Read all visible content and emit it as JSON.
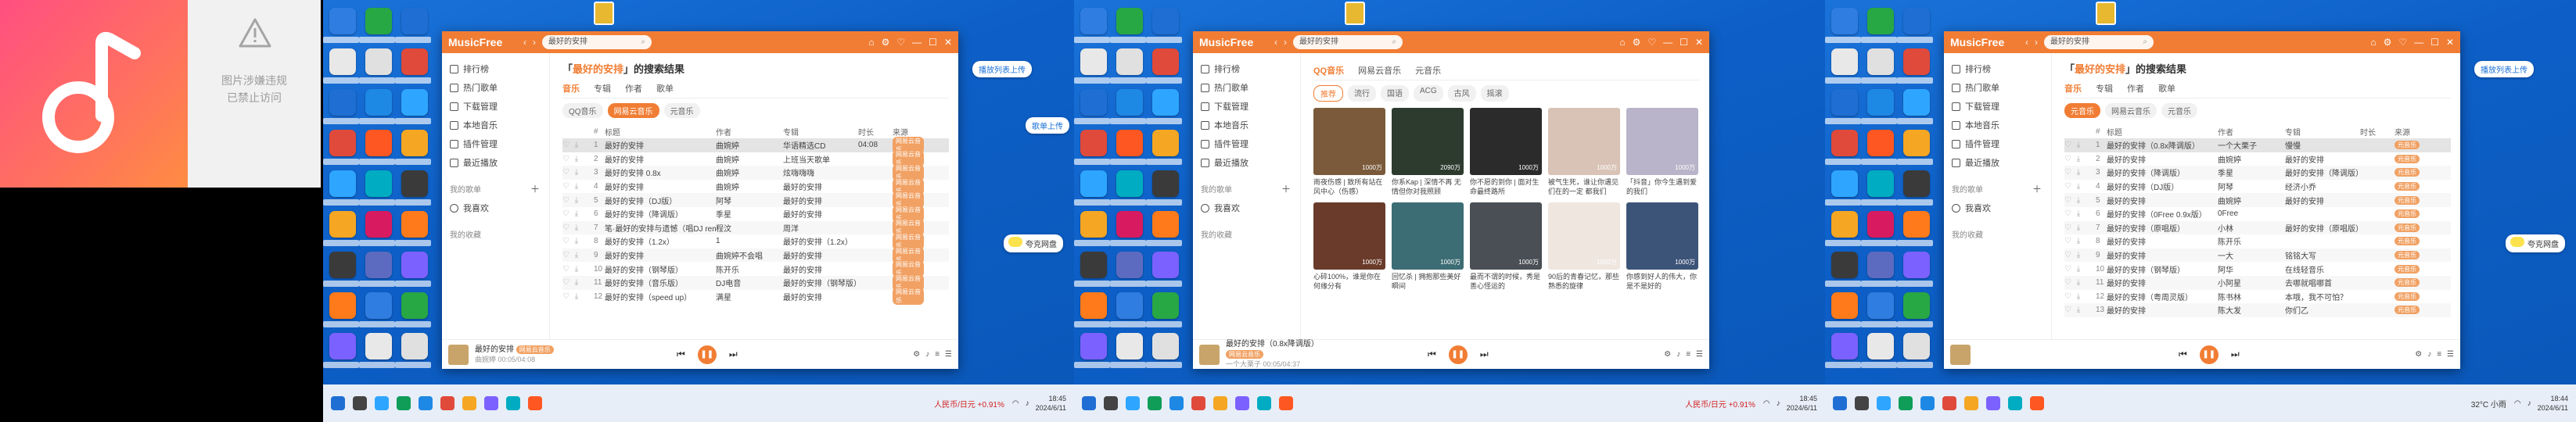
{
  "placeholder": {
    "line1": "图片涉嫌违规",
    "line2": "已禁止访问"
  },
  "app": {
    "name": "MusicFree",
    "nav_back": "‹",
    "nav_forward": "›",
    "window_controls": [
      "⌂",
      "⚙",
      "♡",
      "—",
      "☐",
      "✕"
    ]
  },
  "sidebar": {
    "items": [
      {
        "label": "排行榜"
      },
      {
        "label": "热门歌单"
      },
      {
        "label": "下载管理"
      },
      {
        "label": "本地音乐"
      },
      {
        "label": "插件管理"
      },
      {
        "label": "最近播放"
      }
    ],
    "my_playlists": "我的歌单",
    "fav": "我喜欢",
    "collected": "我的收藏"
  },
  "screens": [
    {
      "search": "最好的安排",
      "query": "最好的安排",
      "title_suffix": "的搜索结果",
      "tabs": [
        "音乐",
        "专辑",
        "作者",
        "歌单"
      ],
      "active_tab": 0,
      "chips": [
        "QQ音乐",
        "网易云音乐",
        "元音乐"
      ],
      "active_chip": 1,
      "columns": [
        "#",
        "标题",
        "作者",
        "专辑",
        "时长",
        "来源"
      ],
      "rows": [
        [
          "1",
          "最好的安排",
          "曲婉婷",
          "华语精选CD",
          "04:08",
          "网易云音乐"
        ],
        [
          "2",
          "最好的安排",
          "曲婉婷",
          "上班当天歌单",
          "",
          "网易云音乐"
        ],
        [
          "3",
          "最好的安排 0.8x",
          "曲婉婷",
          "炫嗨嗨嗨",
          "",
          "网易云音乐"
        ],
        [
          "4",
          "最好的安排",
          "曲婉婷",
          "最好的安排",
          "",
          "网易云音乐"
        ],
        [
          "5",
          "最好的安排（DJ版）",
          "阿琴",
          "最好的安排",
          "",
          "网易云音乐"
        ],
        [
          "6",
          "最好的安排（降调版）",
          "季星",
          "最好的安排",
          "",
          "网易云音乐"
        ],
        [
          "7",
          "笔·最好的安排与遗憾（唱DJ remix）",
          "程汶",
          "周洋",
          "",
          "网易云音乐"
        ],
        [
          "8",
          "最好的安排（1.2x）",
          "1",
          "最好的安排（1.2x）",
          "",
          "网易云音乐"
        ],
        [
          "9",
          "最好的安排",
          "曲婉婷不会唱",
          "最好的安排",
          "",
          "网易云音乐"
        ],
        [
          "10",
          "最好的安排（钢琴版）",
          "陈开乐",
          "最好的安排",
          "",
          "网易云音乐"
        ],
        [
          "11",
          "最好的安排（音乐版）",
          "DJ电音",
          "最好的安排（钢琴版）",
          "",
          "网易云音乐"
        ],
        [
          "12",
          "最好的安排（speed up）",
          "满星",
          "最好的安排",
          "",
          "网易云音乐"
        ]
      ],
      "player": {
        "title": "最好的安排",
        "source": "网易云音乐",
        "artist": "曲婉婷",
        "time": "00:05/04:08"
      },
      "pill_top": "播放列表上传",
      "pill_small": "歌单上传",
      "pill_pan": "夸克网盘"
    },
    {
      "search": "最好的安排",
      "tabs_source": [
        "QQ音乐",
        "网易云音乐",
        "元音乐"
      ],
      "filters": [
        "推荐",
        "流行",
        "国语",
        "ACG",
        "古风",
        "摇滚"
      ],
      "active_filter": 0,
      "cards": [
        {
          "title": "雨夜伤感 | 致所有站在风中心（伤感）",
          "sub": "伤感歌曲和你",
          "plays": "1000万"
        },
        {
          "title": "你系Kap | 深情不再 无情但你对我照顾",
          "sub": "",
          "plays": "2090万"
        },
        {
          "title": "你不愿的到你 | 面对生命最终路所",
          "sub": "",
          "plays": "1000万"
        },
        {
          "title": "被气生死，谁让你遇见们在的一定 都我们",
          "sub": "",
          "plays": "1000万"
        },
        {
          "title": "「抖音」你今生遇到爱的我们",
          "sub": "",
          "plays": "1000万"
        },
        {
          "title": "心碎100%，谁是你在何缘分有",
          "sub": "",
          "plays": "1000万"
        },
        {
          "title": "回忆杀 | 拥抱那些美好瞬间",
          "sub": "",
          "plays": "1000万"
        },
        {
          "title": "最而不谓的时候，秀是善心怪运的",
          "sub": "",
          "plays": "1000万"
        },
        {
          "title": "90后的青春记忆，那些熟悉的旋律",
          "sub": "",
          "plays": "1000万"
        },
        {
          "title": "你感到好人的伟大，你是不是好的",
          "sub": "",
          "plays": "1000万"
        }
      ],
      "player": {
        "title": "最好的安排（0.8x降调版）",
        "source": "网易云音乐",
        "artist": "一个大栗子",
        "time": "00:05/04:37"
      }
    },
    {
      "search": "最好的安排",
      "query": "最好的安排",
      "title_suffix": "的搜索结果",
      "tabs": [
        "音乐",
        "专辑",
        "作者",
        "歌单"
      ],
      "chips": [
        "元音乐",
        "网易云音乐",
        "元音乐"
      ],
      "active_chip": 0,
      "columns": [
        "#",
        "标题",
        "作者",
        "专辑",
        "时长",
        "来源"
      ],
      "rows": [
        [
          "1",
          "最好的安排（0.8x降调版）",
          "一个大栗子",
          "慢慢",
          "",
          "元音乐"
        ],
        [
          "2",
          "最好的安排",
          "曲婉婷",
          "最好的安排",
          "",
          "元音乐"
        ],
        [
          "3",
          "最好的安排（降调版）",
          "季星",
          "最好的安排（降调版）",
          "",
          "元音乐"
        ],
        [
          "4",
          "最好的安排（DJ版）",
          "阿琴",
          "经济小乔",
          "",
          "元音乐"
        ],
        [
          "5",
          "最好的安排",
          "曲婉婷",
          "最好的安排",
          "",
          "元音乐"
        ],
        [
          "6",
          "最好的安排（0Free 0.9x版）",
          "0Free",
          "",
          "",
          "元音乐"
        ],
        [
          "7",
          "最好的安排（原唱版）",
          "小林",
          "最好的安排（原唱版）",
          "",
          "元音乐"
        ],
        [
          "8",
          "最好的安排",
          "陈开乐",
          "",
          "",
          "元音乐"
        ],
        [
          "9",
          "最好的安排",
          "一大",
          "铭铭大写",
          "",
          "元音乐"
        ],
        [
          "10",
          "最好的安排（钢琴版）",
          "阿华",
          "在线轻音乐",
          "",
          "元音乐"
        ],
        [
          "11",
          "最好的安排",
          "小阿星",
          "去哪就唱哪首",
          "",
          "元音乐"
        ],
        [
          "12",
          "最好的安排（粤周灵版）",
          "陈书林",
          "本哦，我不可怕？",
          "",
          "元音乐"
        ],
        [
          "13",
          "最好的安排",
          "陈大发",
          "你们乙",
          "",
          "元音乐"
        ]
      ],
      "player": {
        "title": "",
        "source": "",
        "artist": "",
        "time": ""
      },
      "pill_top": "播放列表上传",
      "pill_pan": "夸克网盘"
    }
  ],
  "taskbar": {
    "weather_left": "人民币/日元 +0.91%",
    "weather_right": "32°C 小雨",
    "clock": [
      {
        "time": "18:45",
        "date": "2024/6/11"
      },
      {
        "time": "18:45",
        "date": "2024/6/11"
      },
      {
        "time": "18:44",
        "date": "2024/6/11"
      }
    ]
  },
  "colors": {
    "accent": "#f17d34",
    "desktop": "#0d5fc7",
    "promo": "#ff5f6d"
  },
  "icons": [
    "music-note-icon",
    "warning-icon",
    "search-icon",
    "play-icon",
    "pause-icon",
    "prev-icon",
    "next-icon"
  ]
}
